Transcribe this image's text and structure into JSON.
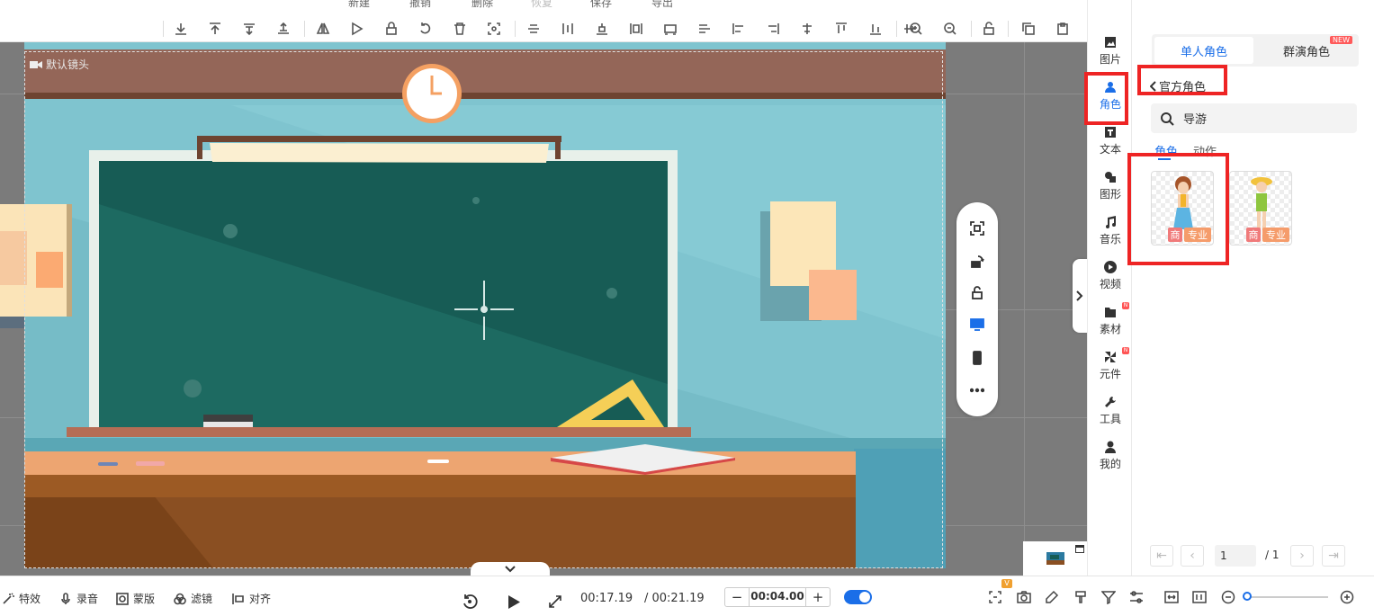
{
  "top_menu": {
    "items": [
      "新建",
      "撤销",
      "删除",
      "恢复",
      "保存",
      "导出"
    ]
  },
  "toolbar": {
    "buttons": [
      "align-bottom-icon",
      "align-top-icon",
      "move-down-icon",
      "move-up-icon",
      "flip-h-icon",
      "flip-v-icon",
      "lock-icon",
      "rotate-icon",
      "delete-icon",
      "crop-icon",
      "center-h-icon",
      "center-v-icon",
      "distribute-h-icon",
      "distribute-v-icon",
      "fit-icon",
      "stretch-icon",
      "align-left-icon",
      "align-right-icon",
      "center-icon",
      "align-top2-icon",
      "align-bottom2-icon",
      "middle-icon",
      "zoom-in-icon",
      "zoom-out-icon",
      "unlock-icon",
      "copy-icon",
      "paste-icon"
    ]
  },
  "canvas": {
    "camera_label": "默认镜头"
  },
  "float_bar": {
    "buttons": [
      "screen-capture-icon",
      "rotate-icon",
      "unlock-icon",
      "desktop-icon",
      "mobile-icon",
      "more-icon"
    ]
  },
  "sidebar": {
    "items": [
      {
        "label": "图片",
        "icon": "image-icon"
      },
      {
        "label": "角色",
        "icon": "person-icon",
        "active": true
      },
      {
        "label": "文本",
        "icon": "text-icon"
      },
      {
        "label": "图形",
        "icon": "shape-icon"
      },
      {
        "label": "音乐",
        "icon": "music-icon"
      },
      {
        "label": "视频",
        "icon": "video-icon"
      },
      {
        "label": "素材",
        "icon": "folder-icon",
        "badge": "N"
      },
      {
        "label": "元件",
        "icon": "component-icon",
        "badge": "N"
      },
      {
        "label": "工具",
        "icon": "wrench-icon"
      },
      {
        "label": "我的",
        "icon": "user-icon"
      }
    ]
  },
  "panel": {
    "tabs": [
      {
        "label": "单人角色",
        "active": true
      },
      {
        "label": "群演角色",
        "badge": "NEW"
      }
    ],
    "back_label": "官方角色",
    "search": {
      "value": "导游",
      "placeholder": ""
    },
    "sub_tabs": [
      {
        "label": "角色",
        "active": true
      },
      {
        "label": "动作"
      }
    ],
    "characters": [
      {
        "tags": [
          "商",
          "专业"
        ]
      },
      {
        "tags": [
          "商",
          "专业"
        ]
      }
    ],
    "pager": {
      "current": "1",
      "total": "/ 1"
    }
  },
  "bottom": {
    "tools": [
      "特效",
      "录音",
      "蒙版",
      "滤镜",
      "对齐"
    ],
    "current_time": "00:17.19",
    "total_time": "/ 00:21.19",
    "duration": "00:04.00",
    "duration_minus": "−",
    "duration_plus": "+",
    "badge_v": "V",
    "zoom_level": 0.0
  }
}
